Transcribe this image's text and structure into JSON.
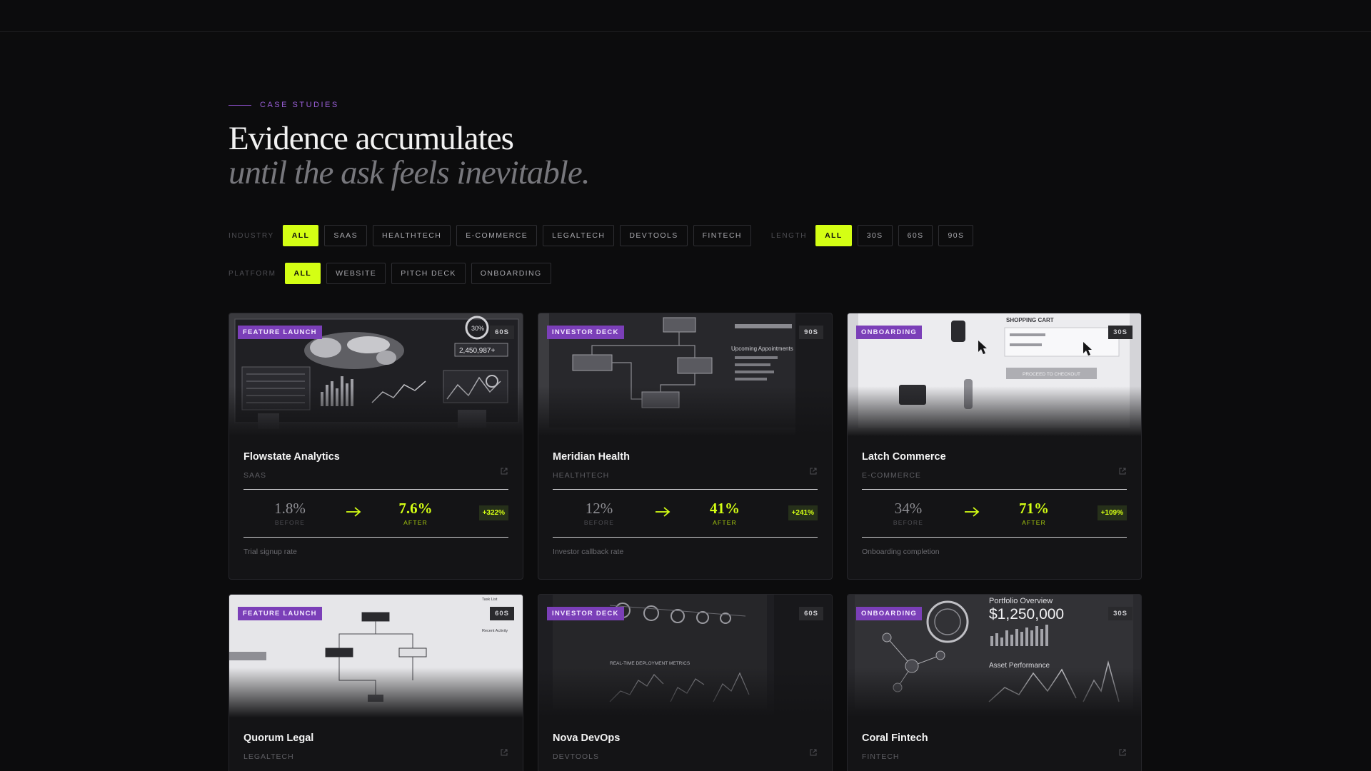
{
  "section": {
    "eyebrow": "CASE STUDIES",
    "headline": "Evidence accumulates",
    "subline": "until the ask feels inevitable."
  },
  "filters": {
    "industry": {
      "label": "INDUSTRY",
      "options": [
        "ALL",
        "SAAS",
        "HEALTHTECH",
        "E-COMMERCE",
        "LEGALTECH",
        "DEVTOOLS",
        "FINTECH"
      ],
      "selected": "ALL"
    },
    "length": {
      "label": "LENGTH",
      "options": [
        "ALL",
        "30S",
        "60S",
        "90S"
      ],
      "selected": "ALL"
    },
    "platform": {
      "label": "PLATFORM",
      "options": [
        "ALL",
        "WEBSITE",
        "PITCH DECK",
        "ONBOARDING"
      ],
      "selected": "ALL"
    }
  },
  "cards": [
    {
      "tag": "FEATURE LAUNCH",
      "duration": "60S",
      "title": "Flowstate Analytics",
      "industry": "SAAS",
      "before": "1.8%",
      "before_label": "BEFORE",
      "after": "7.6%",
      "after_label": "AFTER",
      "lift": "+322%",
      "caption": "Trial signup rate",
      "thumb": "dashboard-world-map",
      "thumb_texts": [
        "30%",
        "2,450,987+"
      ]
    },
    {
      "tag": "INVESTOR DECK",
      "duration": "90S",
      "title": "Meridian Health",
      "industry": "HEALTHTECH",
      "before": "12%",
      "before_label": "BEFORE",
      "after": "41%",
      "after_label": "AFTER",
      "lift": "+241%",
      "caption": "Investor callback rate",
      "thumb": "flowchart-appointments",
      "thumb_texts": [
        "Upcoming Appointments"
      ]
    },
    {
      "tag": "ONBOARDING",
      "duration": "30S",
      "title": "Latch Commerce",
      "industry": "E-COMMERCE",
      "before": "34%",
      "before_label": "BEFORE",
      "after": "71%",
      "after_label": "AFTER",
      "lift": "+109%",
      "caption": "Onboarding completion",
      "thumb": "shopping-cart",
      "thumb_texts": [
        "SHOPPING CART",
        "PROCEED TO CHECKOUT"
      ]
    },
    {
      "tag": "FEATURE LAUNCH",
      "duration": "60S",
      "title": "Quorum Legal",
      "industry": "LEGALTECH",
      "thumb": "legal-workflow",
      "thumb_texts": [
        "Task List",
        "Recent Activity"
      ]
    },
    {
      "tag": "INVESTOR DECK",
      "duration": "60S",
      "title": "Nova DevOps",
      "industry": "DEVTOOLS",
      "thumb": "deployment-metrics",
      "thumb_texts": [
        "REAL-TIME DEPLOYMENT METRICS"
      ]
    },
    {
      "tag": "ONBOARDING",
      "duration": "30S",
      "title": "Coral Fintech",
      "industry": "FINTECH",
      "thumb": "portfolio-overview",
      "thumb_texts": [
        "Portfolio Overview",
        "$1,250,000",
        "Asset Performance"
      ]
    }
  ],
  "colors": {
    "accent": "#d4ff14",
    "tag": "#7b3fb8",
    "eyebrow": "#9a5fd8",
    "bg": "#0c0c0d"
  },
  "icons": {
    "card_link": "external-link-icon",
    "metric_arrow": "arrow-right-icon"
  }
}
